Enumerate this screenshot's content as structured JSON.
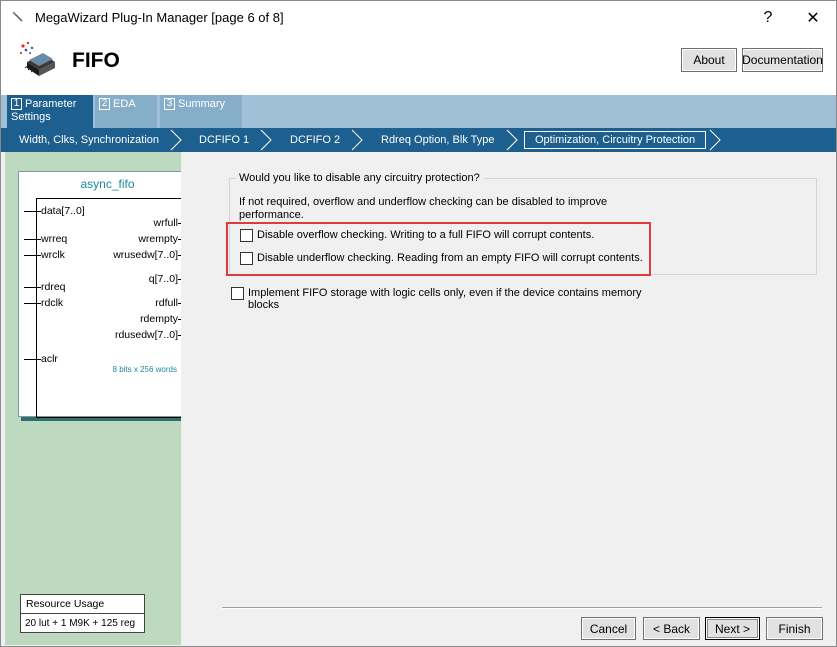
{
  "window": {
    "title": "MegaWizard Plug-In Manager [page 6 of 8]",
    "help_glyph": "?",
    "close_glyph": "✕"
  },
  "header": {
    "title": "FIFO",
    "about_label": "About",
    "documentation_label": "Documentation"
  },
  "tabs": [
    {
      "number": "1",
      "label": "Parameter Settings",
      "active": true
    },
    {
      "number": "2",
      "label": "EDA",
      "active": false
    },
    {
      "number": "3",
      "label": "Summary",
      "active": false
    }
  ],
  "steps": [
    {
      "label": "Width, Clks, Synchronization"
    },
    {
      "label": "DCFIFO 1"
    },
    {
      "label": "DCFIFO 2"
    },
    {
      "label": "Rdreq Option, Blk Type"
    },
    {
      "label": "Optimization, Circuitry Protection",
      "current": true
    }
  ],
  "symbol": {
    "name": "async_fifo",
    "pins_left": [
      "data[7..0]",
      "wrreq",
      "wrclk",
      "rdreq",
      "rdclk",
      "aclr"
    ],
    "pins_right": [
      "wrfull",
      "wrempty",
      "wrusedw[7..0]",
      "q[7..0]",
      "rdfull",
      "rdempty",
      "rdusedw[7..0]"
    ],
    "note": "8 bits x 256 words"
  },
  "resource": {
    "title": "Resource Usage",
    "value": "20 lut + 1 M9K + 125 reg"
  },
  "protection": {
    "legend": "Would you like to disable any circuitry protection?",
    "description": "If not required, overflow and underflow checking can be disabled to improve performance.",
    "overflow_label": "Disable overflow checking. Writing to a full FIFO will corrupt contents.",
    "overflow_checked": false,
    "underflow_label": "Disable underflow checking. Reading from an empty FIFO will corrupt contents.",
    "underflow_checked": false,
    "highlight_color": "#e03a3a"
  },
  "logic_cells": {
    "label": "Implement FIFO storage with logic cells only, even if the device contains memory blocks",
    "checked": false
  },
  "footer": {
    "cancel": "Cancel",
    "back": "< Back",
    "next": "Next >",
    "finish": "Finish"
  },
  "colors": {
    "tab_active": "#1d5f8e",
    "tab_strip": "#9fc0d6",
    "left_panel": "#bdd9c0",
    "symbol_title": "#1a8a9a"
  }
}
